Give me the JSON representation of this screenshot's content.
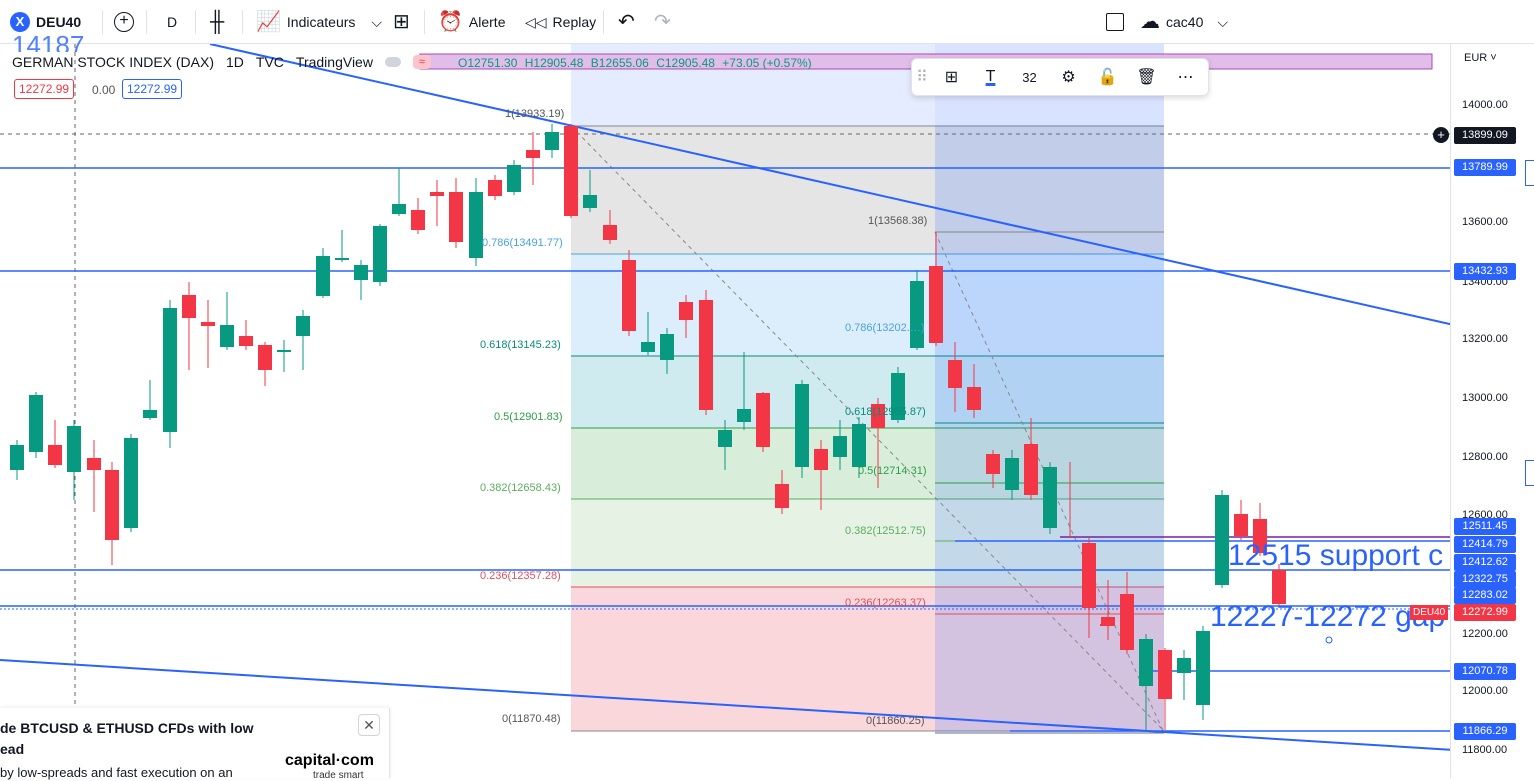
{
  "topbar": {
    "symbol": "DEU40",
    "interval": "D",
    "indicators": "Indicateurs",
    "alert": "Alerte",
    "replay": "Replay",
    "layout_name": "cac40"
  },
  "legend": {
    "title": "GERMAN STOCK INDEX (DAX)",
    "interval": "1D",
    "source": "TVC",
    "provider": "TradingView",
    "open": "O12751.30",
    "high": "H12905.48",
    "low": "B12655.06",
    "close": "C12905.48",
    "change": "+73.05 (+0.57%)",
    "bid": "12272.99",
    "spread": "0.00",
    "ask": "12272.99",
    "clipped_text": "14187"
  },
  "draw_toolbar": {
    "font_size": "32"
  },
  "price_axis": {
    "currency": "EUR",
    "ticks": [
      "14000.00",
      "13600.00",
      "13400.00",
      "13200.00",
      "13000.00",
      "12800.00",
      "12600.00",
      "12200.00",
      "12000.00",
      "11800.00"
    ],
    "labels": [
      {
        "text": "13899.09",
        "kind": "crosshair"
      },
      {
        "text": "13789.99",
        "kind": "line"
      },
      {
        "text": "13432.93",
        "kind": "line"
      },
      {
        "text": "12511.45",
        "kind": "line"
      },
      {
        "text": "12414.79",
        "kind": "line"
      },
      {
        "text": "12412.62",
        "kind": "line"
      },
      {
        "text": "12322.75",
        "kind": "line"
      },
      {
        "text": "12283.02",
        "kind": "line"
      },
      {
        "text": "12272.99",
        "kind": "last"
      },
      {
        "text": "12070.78",
        "kind": "line"
      },
      {
        "text": "11866.29",
        "kind": "line"
      }
    ],
    "last_symbol_tag": "DEU40"
  },
  "fib1": {
    "levels": [
      "1(13933.19)",
      "0.786(13491.77)",
      "0.618(13145.23)",
      "0.5(12901.83)",
      "0.382(12658.43)",
      "0.236(12357.28)",
      "0(11870.48)"
    ]
  },
  "fib2": {
    "levels": [
      "1(13568.38)",
      "0.786(13202.…)",
      "0.618(12955.87)",
      "0.5(12714.31)",
      "0.382(12512.75)",
      "0.236(12263.37)",
      "0(11860.25)"
    ]
  },
  "annotations": {
    "support": "12515 support c",
    "gap": "12227-12272 gap"
  },
  "ad": {
    "line1": "de BTCUSD & ETHUSD CFDs with low",
    "line2": "ead",
    "line3": "by low-spreads and fast execution on an",
    "brand": "capital·com",
    "tagline": "trade smart"
  },
  "colors": {
    "up": "#089981",
    "down": "#f23645",
    "line": "#2962ff",
    "accent": "#2962ff"
  }
}
